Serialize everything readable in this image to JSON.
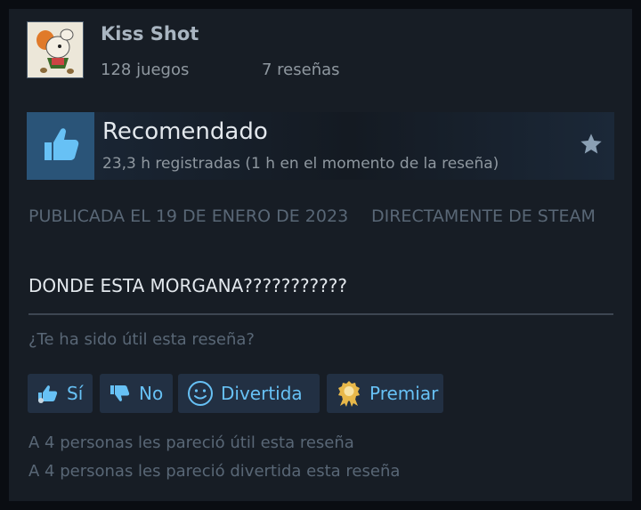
{
  "author": {
    "name": "Kiss Shot",
    "games": "128 juegos",
    "reviews": "7 reseñas"
  },
  "vote": {
    "title": "Recomendado",
    "hours": "23,3 h registradas (1 h en el momento de la reseña)",
    "icon": "thumbs-up-icon"
  },
  "meta": {
    "posted": "PUBLICADA EL 19 DE ENERO DE 2023",
    "source": "DIRECTAMENTE DE STEAM"
  },
  "review": {
    "text": "DONDE ESTA MORGANA???????????"
  },
  "helpful": {
    "question": "¿Te ha sido útil esta reseña?",
    "buttons": {
      "yes": "Sí",
      "no": "No",
      "funny": "Divertida",
      "award": "Premiar"
    }
  },
  "stats": {
    "helpful": "A 4 personas les pareció útil esta reseña",
    "funny": "A 4 personas les pareció divertida esta reseña"
  },
  "colors": {
    "background": "#171d25",
    "accent": "#67c1f5",
    "thumb_box": "#2a5478",
    "award": "#e8b84a"
  }
}
